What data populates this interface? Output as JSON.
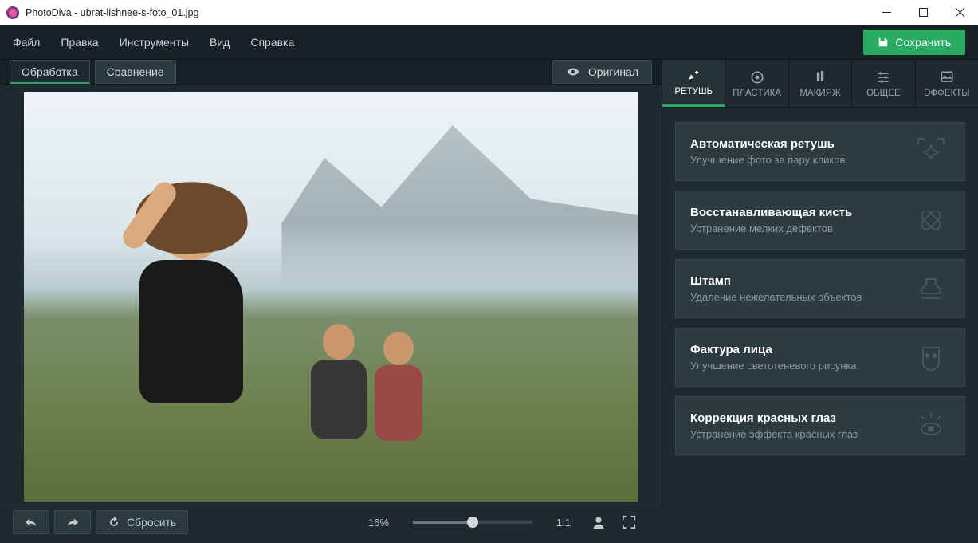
{
  "window": {
    "title": "PhotoDiva - ubrat-lishnee-s-foto_01.jpg"
  },
  "menu": {
    "file": "Файл",
    "edit": "Правка",
    "tools": "Инструменты",
    "view": "Вид",
    "help": "Справка"
  },
  "save_label": "Сохранить",
  "topstrip": {
    "process": "Обработка",
    "compare": "Сравнение",
    "original": "Оригинал"
  },
  "bottombar": {
    "reset": "Сбросить",
    "zoom_pct": "16%",
    "one_to_one": "1:1"
  },
  "sidetabs": {
    "retouch": "РЕТУШЬ",
    "plastic": "ПЛАСТИКА",
    "makeup": "МАКИЯЖ",
    "general": "ОБЩЕЕ",
    "effects": "ЭФФЕКТЫ"
  },
  "cards": [
    {
      "title": "Автоматическая ретушь",
      "sub": "Улучшение фото за пару кликов"
    },
    {
      "title": "Восстанавливающая кисть",
      "sub": "Устранение мелких дефектов"
    },
    {
      "title": "Штамп",
      "sub": "Удаление нежелательных объектов"
    },
    {
      "title": "Фактура лица",
      "sub": "Улучшение светотеневого рисунка"
    },
    {
      "title": "Коррекция красных глаз",
      "sub": "Устранение эффекта красных глаз"
    }
  ]
}
